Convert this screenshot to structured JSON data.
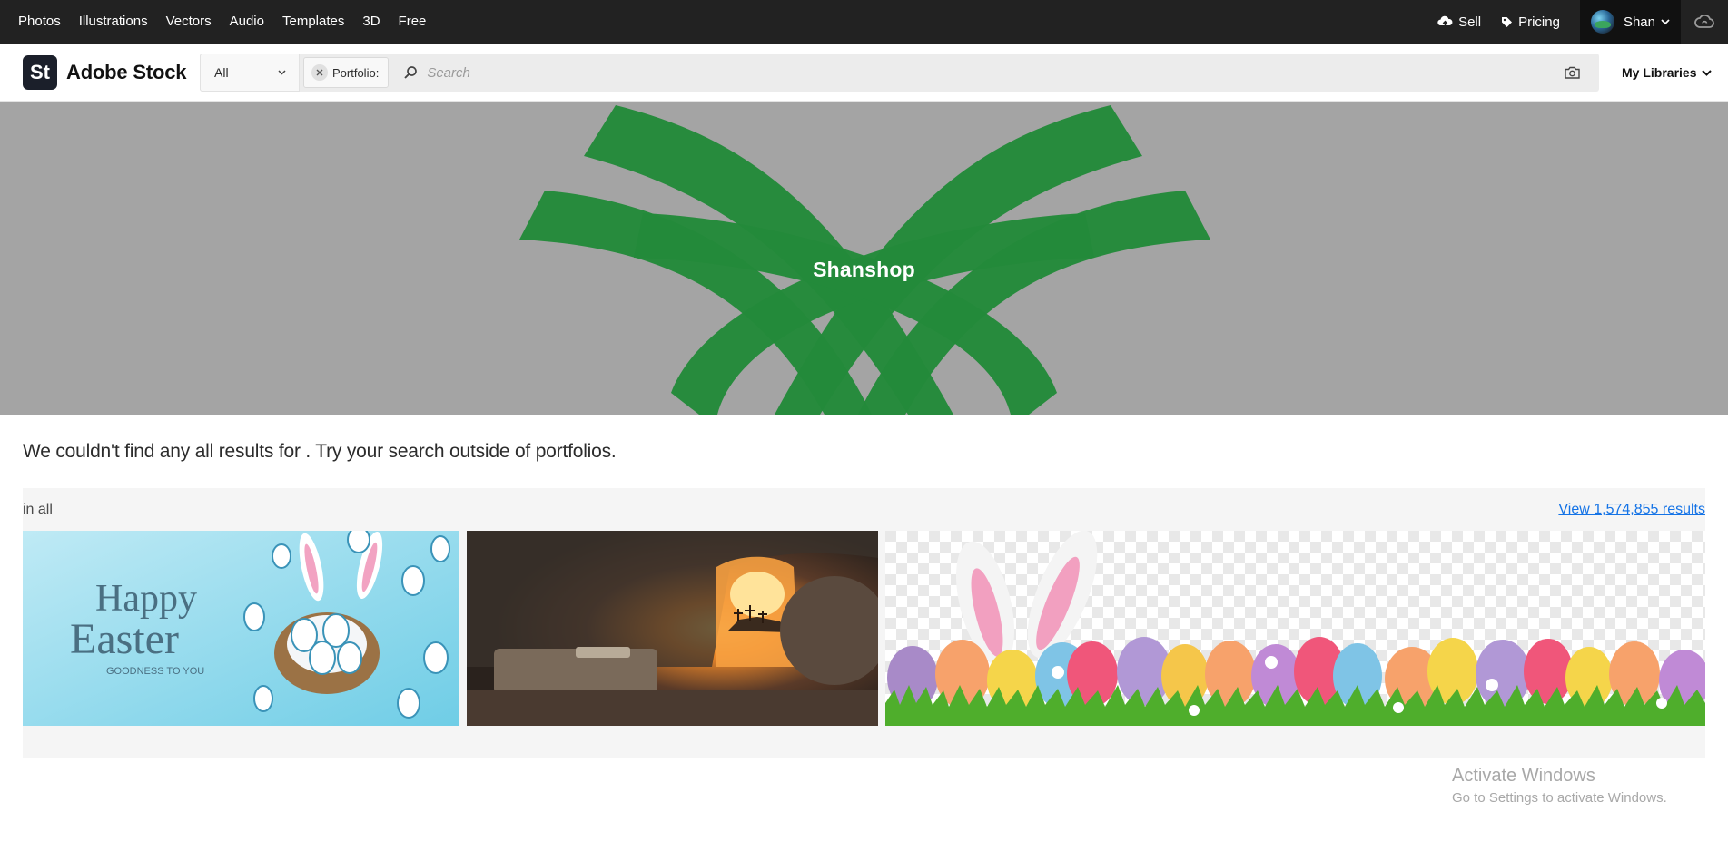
{
  "topbar": {
    "nav": [
      "Photos",
      "Illustrations",
      "Vectors",
      "Audio",
      "Templates",
      "3D",
      "Free"
    ],
    "sell_label": "Sell",
    "pricing_label": "Pricing",
    "user_name": "Shan"
  },
  "header": {
    "logo_badge": "St",
    "logo_text": "Adobe Stock",
    "filter_value": "All",
    "portfolio_tag": "Portfolio:",
    "search_placeholder": "Search",
    "my_libraries": "My Libraries"
  },
  "hero": {
    "title": "Shanshop",
    "colors": {
      "background": "#a4a4a4",
      "shape": "#238a3a"
    }
  },
  "results": {
    "message": "We couldn't find any all results for . Try your search outside of portfolios.",
    "section_label": "in all",
    "view_link": "View 1,574,855 results",
    "thumbnails": [
      {
        "name": "happy-easter-card",
        "text_line1": "Happy",
        "text_line2": "Easter",
        "text_line3": "GOODNESS TO YOU"
      },
      {
        "name": "empty-tomb-sunrise"
      },
      {
        "name": "easter-eggs-bunny-ears"
      }
    ]
  },
  "watermark": {
    "title": "Activate Windows",
    "subtitle": "Go to Settings to activate Windows."
  },
  "colors": {
    "topbar": "#222222",
    "link": "#1473e6",
    "panel": "#f5f5f5"
  }
}
